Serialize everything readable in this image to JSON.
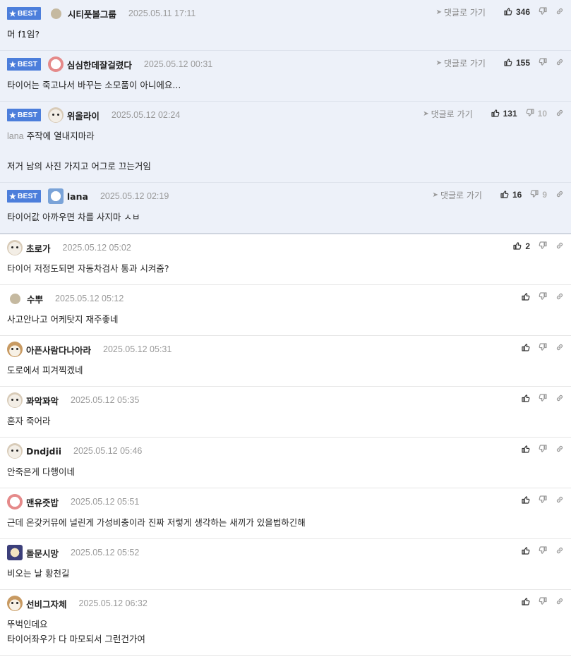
{
  "ui": {
    "reply_label": "댓글로 가기",
    "best_label": "BEST",
    "star": "★",
    "reply_arrow": "➤"
  },
  "colors": {
    "best_badge": "#4c7edb",
    "best_bg": "#edf1f9"
  },
  "comments": [
    {
      "best": true,
      "avatar": "av-gray",
      "avatar_size": "small",
      "nick": "시티풋볼그룹",
      "date": "2025.05.11 17:11",
      "up": "346",
      "down": "",
      "lines": [
        "머 f1임?"
      ]
    },
    {
      "best": true,
      "avatar": "av-red",
      "nick": "심심한데잘걸렸다",
      "date": "2025.05.12 00:31",
      "up": "155",
      "down": "",
      "lines": [
        "타이어는 죽고나서 바꾸는 소모품이 아니에요..."
      ]
    },
    {
      "best": true,
      "avatar": "av-dog",
      "nick": "위올라이",
      "date": "2025.05.12 02:24",
      "up": "131",
      "down": "10",
      "mention": "lana",
      "lines": [
        "주작에 열내지마라",
        "",
        "저거 남의 사진 가지고 어그로 끄는거임"
      ]
    },
    {
      "best": true,
      "avatar": "av-blue",
      "nick": "lana",
      "date": "2025.05.12 02:19",
      "up": "16",
      "down": "9",
      "lines": [
        "타이어값 아까우면 차를 사지마 ㅅㅂ"
      ]
    },
    {
      "best": false,
      "avatar": "av-dog",
      "nick": "초로가",
      "date": "2025.05.12 05:02",
      "up": "2",
      "down": "",
      "lines": [
        "타이어 저정도되면 자동차검사 통과 시켜줌?"
      ]
    },
    {
      "best": false,
      "avatar": "av-gray",
      "avatar_size": "small",
      "nick": "수뿌",
      "date": "2025.05.12 05:12",
      "up": "",
      "down": "",
      "lines": [
        "사고안나고 어케탓지 재주좋네"
      ]
    },
    {
      "best": false,
      "avatar": "av-fox",
      "nick": "아픈사람다나아라",
      "date": "2025.05.12 05:31",
      "up": "",
      "down": "",
      "lines": [
        "도로에서 피겨찍겠네"
      ]
    },
    {
      "best": false,
      "avatar": "av-dog",
      "nick": "꽈악꽈악",
      "date": "2025.05.12 05:35",
      "up": "",
      "down": "",
      "lines": [
        "혼자 죽어라"
      ]
    },
    {
      "best": false,
      "avatar": "av-dog",
      "nick": "Dndjdii",
      "date": "2025.05.12 05:46",
      "up": "",
      "down": "",
      "lines": [
        "안죽은게 다행이네"
      ]
    },
    {
      "best": false,
      "avatar": "av-red",
      "nick": "맨유즛밥",
      "date": "2025.05.12 05:51",
      "up": "",
      "down": "",
      "lines": [
        "근데 온갖커뮤에 널린게 가성비충이라 진짜 저렇게 생각하는 새끼가 있을법하긴해"
      ]
    },
    {
      "best": false,
      "avatar": "av-dark",
      "nick": "돌문시망",
      "date": "2025.05.12 05:52",
      "up": "",
      "down": "",
      "lines": [
        "비오는 날 황천길"
      ]
    },
    {
      "best": false,
      "avatar": "av-fox",
      "nick": "선비그자체",
      "date": "2025.05.12 06:32",
      "up": "",
      "down": "",
      "lines": [
        "뚜벅인데요",
        "타이어좌우가 다 마모되서 그런건가여"
      ]
    }
  ]
}
